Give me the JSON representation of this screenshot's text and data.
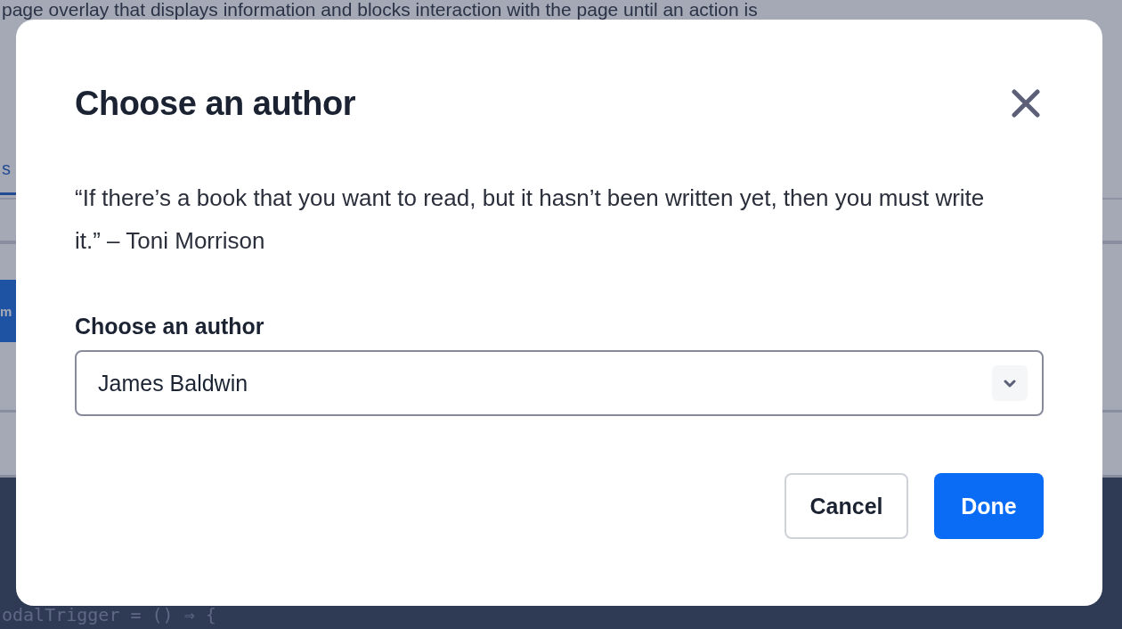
{
  "background": {
    "intro": "page overlay that displays information and blocks interaction with the page until an action is",
    "tab": "s",
    "button": "m",
    "code": "odalTrigger = () ⇒ {"
  },
  "modal": {
    "title": "Choose an author",
    "quote": "“If there’s a book that you want to read, but it hasn’t been written yet, then you must write it.” – Toni Morrison",
    "select": {
      "label": "Choose an author",
      "value": "James Baldwin"
    },
    "buttons": [
      {
        "label": "Cancel",
        "kind": "secondary"
      },
      {
        "label": "Done",
        "kind": "primary"
      }
    ]
  }
}
